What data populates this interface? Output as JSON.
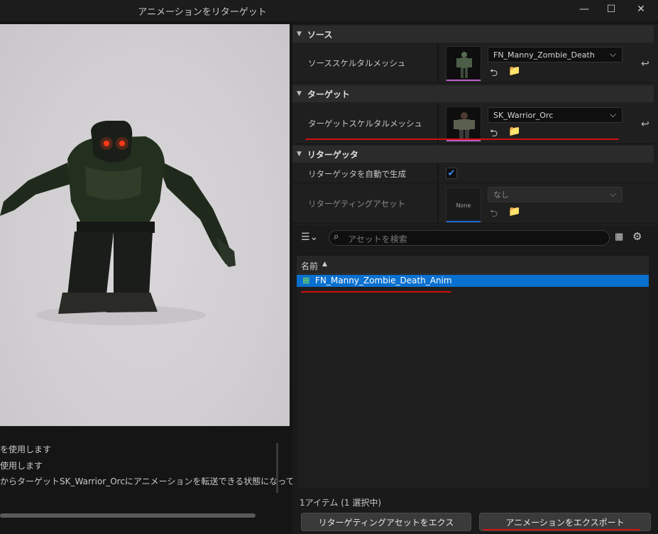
{
  "window": {
    "title": "アニメーションをリターゲット",
    "minimize_glyph": "—",
    "maximize_glyph": "☐",
    "close_glyph": "✕"
  },
  "source": {
    "section_label": "ソース",
    "row_label": "ソーススケルタルメッシュ",
    "value": "FN_Manny_Zombie_Death",
    "accent": "#c05ad0"
  },
  "target": {
    "section_label": "ターゲット",
    "row_label": "ターゲットスケルタルメッシュ",
    "value": "SK_Warrior_Orc",
    "accent": "#c05ad0"
  },
  "retargeter": {
    "section_label": "リターゲッタ",
    "auto_generate_label": "リターゲッタを自動で生成",
    "auto_generate_checked": true,
    "asset_label": "リターゲティングアセット",
    "asset_value": "なし",
    "thumb_text": "None",
    "accent": "#1a6ad0"
  },
  "browser": {
    "search_placeholder": "アセットを検索",
    "column_name": "名前",
    "items": [
      {
        "name": "FN_Manny_Zombie_Death_Anim",
        "selected": true
      }
    ],
    "status": "1アイテム (1 選択中)"
  },
  "log": {
    "lines": [
      "を使用します",
      "使用します",
      "からターゲットSK_Warrior_Orcにアニメーションを転送できる状態になって"
    ]
  },
  "buttons": {
    "export_retarget_asset": "リターゲティングアセットをエクス",
    "export_animation": "アニメーションをエクスポート"
  },
  "icons": {
    "search": "search-icon",
    "filter": "filter-icon",
    "settings": "gear-icon",
    "reset": "reset-arrow-icon"
  },
  "colors": {
    "selection": "#0a70d0",
    "annotation": "#d01010",
    "checkbox": "#1a6ad0"
  }
}
